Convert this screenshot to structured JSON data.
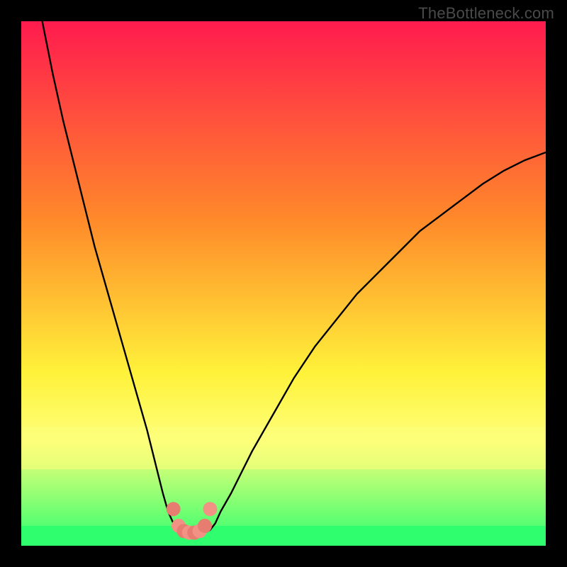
{
  "watermark": "TheBottleneck.com",
  "colors": {
    "background": "#000000",
    "grad_top": "#ff1b4e",
    "grad_orange": "#ff8a2a",
    "grad_yellow": "#fff23a",
    "grad_pale": "#fdff7a",
    "grad_green": "#2fff6f",
    "curve": "#000000",
    "marker_fill": "#e77c70",
    "marker_fill2": "#f19285"
  },
  "chart_data": {
    "type": "line",
    "title": "",
    "xlabel": "",
    "ylabel": "",
    "xlim": [
      0,
      100
    ],
    "ylim": [
      0,
      100
    ],
    "series": [
      {
        "name": "left-branch",
        "x": [
          4,
          6,
          8,
          10,
          12,
          14,
          16,
          18,
          20,
          22,
          24,
          26,
          27,
          28,
          29,
          30,
          31
        ],
        "y": [
          100,
          90,
          81,
          73,
          65,
          57,
          50,
          43,
          36,
          29,
          22,
          14,
          10,
          6.5,
          4.3,
          3,
          2.5
        ]
      },
      {
        "name": "right-branch",
        "x": [
          35,
          36,
          37,
          38,
          40,
          42,
          44,
          48,
          52,
          56,
          60,
          64,
          68,
          72,
          76,
          80,
          84,
          88,
          92,
          96,
          100
        ],
        "y": [
          2.5,
          3,
          4.3,
          6.5,
          10,
          14,
          18,
          25,
          32,
          38,
          43,
          48,
          52,
          56,
          60,
          63,
          66,
          69,
          71.5,
          73.5,
          75
        ]
      }
    ],
    "markers": [
      {
        "x": 29,
        "y": 7.0
      },
      {
        "x": 30,
        "y": 3.8
      },
      {
        "x": 31,
        "y": 2.8
      },
      {
        "x": 32,
        "y": 2.5
      },
      {
        "x": 33,
        "y": 2.5
      },
      {
        "x": 34,
        "y": 2.8
      },
      {
        "x": 35,
        "y": 3.8
      },
      {
        "x": 36,
        "y": 7.0
      }
    ]
  }
}
